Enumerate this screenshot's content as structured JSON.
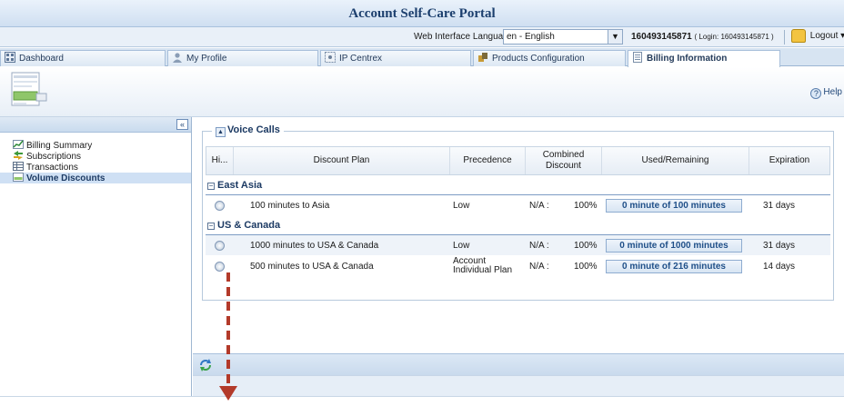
{
  "app": {
    "title": "Account Self-Care Portal"
  },
  "topbar": {
    "language_label": "Web Interface Language:",
    "language_value": "en - English",
    "account_number": "160493145871",
    "login_text": "( Login: 160493145871 )",
    "logout_label": "Logout",
    "logout_arrow": "▾"
  },
  "tabs": [
    {
      "label": "Dashboard",
      "icon": "dashboard-icon"
    },
    {
      "label": "My Profile",
      "icon": "user-icon"
    },
    {
      "label": "IP Centrex",
      "icon": "network-icon"
    },
    {
      "label": "Products Configuration",
      "icon": "gear-icon"
    },
    {
      "label": "Billing Information",
      "icon": "document-icon",
      "active": true
    }
  ],
  "toolbar": {
    "help_label": "Help"
  },
  "sidebar": {
    "collapse_label": "«",
    "items": [
      {
        "label": "Billing Summary",
        "icon": "chart-icon"
      },
      {
        "label": "Subscriptions",
        "icon": "arrows-icon"
      },
      {
        "label": "Transactions",
        "icon": "table-icon"
      },
      {
        "label": "Volume Discounts",
        "icon": "discount-icon",
        "selected": true
      }
    ]
  },
  "main": {
    "section_title": "Voice Calls",
    "section_toggle": "▲",
    "columns": {
      "hi": "Hi...",
      "discount_plan": "Discount Plan",
      "precedence": "Precedence",
      "combined_discount": "Combined Discount",
      "used_remaining": "Used/Remaining",
      "expiration": "Expiration"
    },
    "groups": [
      {
        "name": "East Asia",
        "toggle": "−",
        "rows": [
          {
            "plan": "100 minutes to Asia",
            "precedence": "Low",
            "combined_na": "N/A :",
            "combined_pct": "100%",
            "used": "0 minute of 100 minutes",
            "expiration": "31 days"
          }
        ]
      },
      {
        "name": "US & Canada",
        "toggle": "−",
        "rows": [
          {
            "plan": "1000 minutes to USA & Canada",
            "precedence": "Low",
            "combined_na": "N/A :",
            "combined_pct": "100%",
            "used": "0 minute of 1000 minutes",
            "expiration": "31 days"
          },
          {
            "plan": "500 minutes to USA & Canada",
            "precedence": "Account Individual Plan",
            "combined_na": "N/A :",
            "combined_pct": "100%",
            "used": "0 minute of 216 minutes",
            "expiration": "14 days"
          }
        ]
      }
    ]
  },
  "colors": {
    "accent": "#1c3a63",
    "annotation_arrow": "#b33a2a",
    "selected_bg": "#cfe0f4"
  }
}
